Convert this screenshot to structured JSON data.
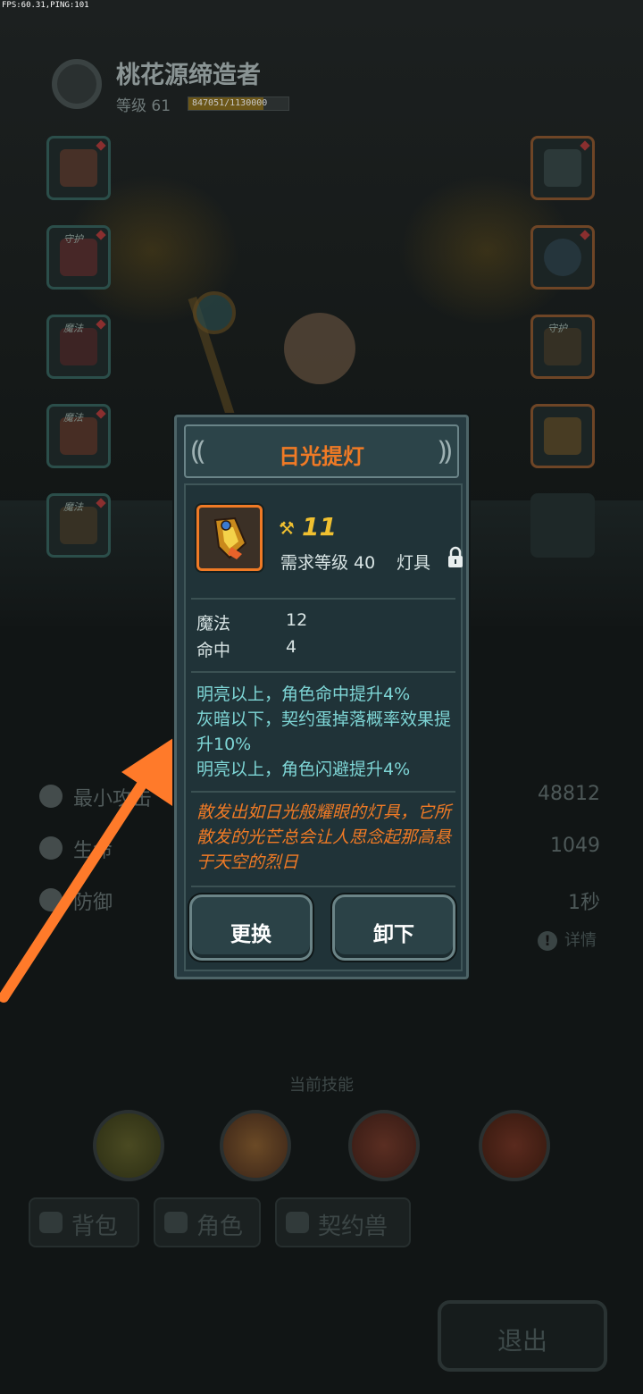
{
  "debug": {
    "fps_text": "FPS:60.31,PING:101"
  },
  "player": {
    "name": "桃花源缔造者",
    "level_text": "等级 61",
    "xp_text": "847051/1130000",
    "xp_progress": 0.75
  },
  "equip_slots": {
    "left": [
      {
        "name": "weapon",
        "tag": "",
        "icon": "sword-icon"
      },
      {
        "name": "armor",
        "tag": "守护",
        "icon": "robe-icon"
      },
      {
        "name": "boots",
        "tag": "魔法",
        "icon": "boots-icon"
      },
      {
        "name": "gloves",
        "tag": "魔法",
        "icon": "bracer-icon"
      },
      {
        "name": "belt",
        "tag": "魔法",
        "icon": "belt-icon"
      }
    ],
    "right": [
      {
        "name": "staff",
        "tag": "",
        "icon": "staff-icon"
      },
      {
        "name": "ring",
        "tag": "",
        "icon": "ring-icon"
      },
      {
        "name": "necklace",
        "tag": "守护",
        "icon": "necklace-icon"
      },
      {
        "name": "lamp",
        "tag": "",
        "icon": "lamp-icon"
      }
    ]
  },
  "stats": [
    {
      "label": "最小攻击",
      "value": "48812",
      "icon": "attack-icon"
    },
    {
      "label": "生命",
      "value": "1049",
      "icon": "heart-icon"
    },
    {
      "label": "防御",
      "value": "1秒",
      "icon": "shield-icon"
    }
  ],
  "detail_link": "详情",
  "skills_title": "当前技能",
  "tabs": [
    {
      "label": "背包",
      "icon": "bag-icon"
    },
    {
      "label": "角色",
      "icon": "character-icon"
    },
    {
      "label": "契约兽",
      "icon": "paw-icon"
    }
  ],
  "exit_label": "退出",
  "modal": {
    "title": "日光提灯",
    "power": "11",
    "required_level": "需求等级 40",
    "item_type": "灯具",
    "attributes": [
      {
        "name": "魔法",
        "value": "12"
      },
      {
        "name": "命中",
        "value": "4"
      }
    ],
    "effects": [
      "明亮以上，角色命中提升4%",
      "灰暗以下，契约蛋掉落概率效果提升10%",
      "明亮以上，角色闪避提升4%"
    ],
    "lore": "散发出如日光般耀眼的灯具，它所散发的光芒总会让人思念起那高悬于天空的烈日",
    "buttons": {
      "replace": "更换",
      "unequip": "卸下"
    }
  },
  "colors": {
    "accent_orange": "#f07a25",
    "effect_cyan": "#7ed6d6",
    "power_gold": "#f0c030",
    "arrow": "#ff7a2a"
  }
}
